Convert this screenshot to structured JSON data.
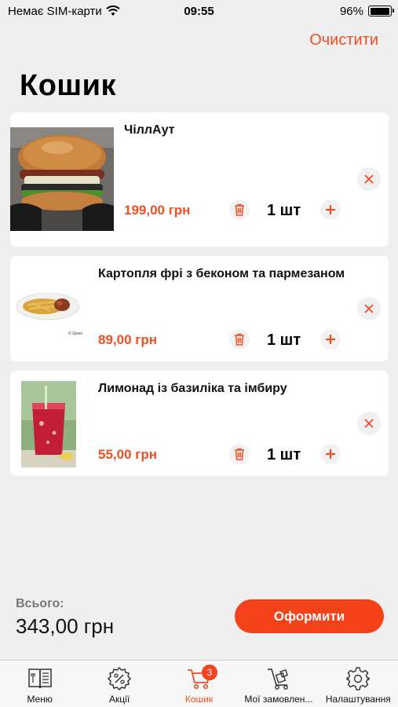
{
  "status_bar": {
    "carrier": "Немає SIM-карти",
    "time": "09:55",
    "battery": "96%",
    "battery_level": 0.96
  },
  "header": {
    "clear_label": "Очистити",
    "title": "Кошик"
  },
  "cart": {
    "items": [
      {
        "name": "ЧіллАут",
        "price": "199,00 грн",
        "quantity": "1 шт"
      },
      {
        "name": "Картопля фрі з беконом та пармезаном",
        "price": "89,00 грн",
        "quantity": "1 шт"
      },
      {
        "name": "Лимонад із базиліка та імбиру",
        "price": "55,00 грн",
        "quantity": "1 шт"
      }
    ]
  },
  "footer": {
    "total_label": "Всього:",
    "total_value": "343,00 грн",
    "checkout_label": "Оформити"
  },
  "tab_bar": {
    "tabs": [
      {
        "label": "Меню",
        "icon": "book-icon"
      },
      {
        "label": "Акції",
        "icon": "discount-icon"
      },
      {
        "label": "Кошик",
        "icon": "cart-icon",
        "badge": "3"
      },
      {
        "label": "Мої замовлен...",
        "icon": "trolley-icon"
      },
      {
        "label": "Налаштування",
        "icon": "gear-icon"
      }
    ]
  },
  "colors": {
    "accent": "#f04e23",
    "background": "#efefef",
    "card": "#ffffff"
  }
}
